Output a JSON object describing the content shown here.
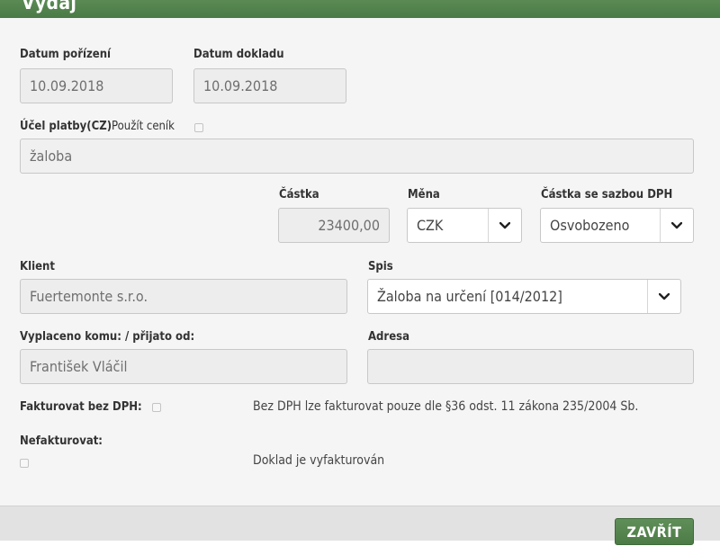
{
  "dialog": {
    "title": "Výdaj"
  },
  "form": {
    "datum_porizeni": {
      "label": "Datum pořízení",
      "value": "10.09.2018"
    },
    "datum_dokladu": {
      "label": "Datum dokladu",
      "value": "10.09.2018"
    },
    "ucel_platby": {
      "label": "Účel platby(CZ)",
      "pricelist_label": "Použít ceník",
      "pricelist_checked": false,
      "value": "žaloba"
    },
    "castka": {
      "label": "Částka",
      "value": "23400,00"
    },
    "mena": {
      "label": "Měna",
      "value": "CZK"
    },
    "castka_dph": {
      "label": "Částka se sazbou DPH",
      "value": "Osvobozeno"
    },
    "klient": {
      "label": "Klient",
      "value": "Fuertemonte s.r.o."
    },
    "spis": {
      "label": "Spis",
      "value": "Žaloba na určení [014/2012]"
    },
    "vyplaceno": {
      "label": "Vyplaceno komu: / přijato od:",
      "value": "František Vláčil"
    },
    "adresa": {
      "label": "Adresa",
      "value": ""
    },
    "fakturovat_bez_dph": {
      "label": "Fakturovat bez DPH:",
      "checked": false,
      "note": "Bez DPH lze fakturovat pouze dle §36 odst. 11 zákona 235/2004 Sb."
    },
    "nefakturovat": {
      "label": "Nefakturovat:",
      "checked": false,
      "note": "Doklad je vyfakturován"
    }
  },
  "footer": {
    "close_label": "ZAVŘÍT"
  },
  "colors": {
    "header": "#4f7f49",
    "button": "#55854e",
    "field_bg": "#ededed",
    "panel_bg": "#f5f5f5"
  }
}
